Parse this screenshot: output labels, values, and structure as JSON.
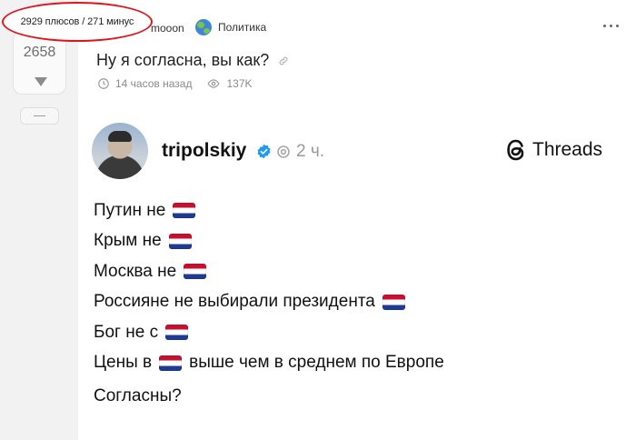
{
  "annotation": {
    "text": "2929 плюсов / 271 минус"
  },
  "vote": {
    "score": "2658"
  },
  "post": {
    "author": "mooon",
    "community": "Политика",
    "title": "Ну я согласна, вы как?",
    "time": "14 часов назад",
    "views": "137K"
  },
  "embed": {
    "username": "tripolskiy",
    "time": "2 ч.",
    "brand": "Threads",
    "lines": [
      {
        "before": "Путин не",
        "after": ""
      },
      {
        "before": "Крым не",
        "after": ""
      },
      {
        "before": "Москва не",
        "after": ""
      },
      {
        "before": "Россияне не выбирали президента",
        "after": ""
      },
      {
        "before": "Бог не с",
        "after": ""
      },
      {
        "before": "Цены в",
        "after": "выше чем в среднем по Европе"
      }
    ],
    "question": "Согласны?"
  },
  "colors": {
    "annotation_ring": "#e0141b",
    "flag_red": "#c8102e",
    "flag_blue": "#1f3a93",
    "verified": "#1d9bf0"
  },
  "icons": [
    "chevron-down-icon",
    "link-icon",
    "clock-icon",
    "eye-icon",
    "verified-icon",
    "threads-icon",
    "more-icon",
    "globe-icon"
  ]
}
